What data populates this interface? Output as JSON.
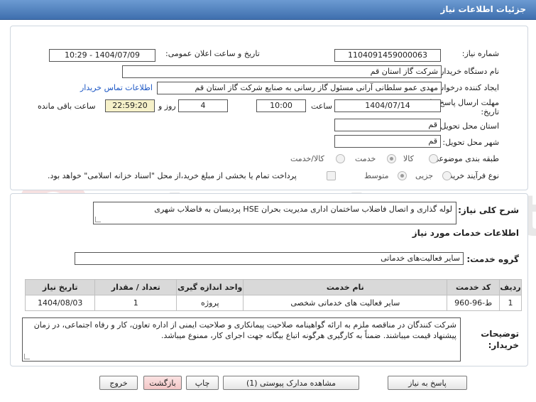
{
  "header": {
    "title": "جزئیات اطلاعات نیاز"
  },
  "form": {
    "need_number_label": "شماره نیاز:",
    "need_number": "1104091459000063",
    "announce_label": "تاریخ و ساعت اعلان عمومی:",
    "announce_value": "1404/07/09 - 10:29",
    "buyer_org_label": "نام دستگاه خریدار:",
    "buyer_org": "شرکت گاز استان قم",
    "requester_label": "ایجاد کننده درخواست:",
    "requester": "مهدی عمو سلطانی آرانی مسئول گاز رسانی به صنایع شرکت گاز استان قم",
    "contact_link": "اطلاعات تماس خریدار",
    "deadline_label_1": "مهلت ارسال پاسخ: تا",
    "deadline_label_2": "تاریخ:",
    "deadline_date": "1404/07/14",
    "time_label": "ساعت",
    "deadline_time": "10:00",
    "days_value": "4",
    "days_label": "روز و",
    "remaining_time": "22:59:20",
    "remaining_label": "ساعت باقی مانده",
    "province_label": "استان محل تحویل:",
    "province": "قم",
    "city_label": "شهر محل تحویل:",
    "city": "قم",
    "category_label": "طبقه بندی موضوعی:",
    "category_options": [
      "کالا",
      "خدمت",
      "کالا/خدمت"
    ],
    "process_label": "نوع فرآیند خرید :",
    "process_options": [
      "جزیی",
      "متوسط"
    ],
    "payment_note": "پرداخت تمام یا بخشی از مبلغ خرید،از محل \"اسناد خزانه اسلامی\" خواهد بود."
  },
  "need": {
    "summary_label": "شرح کلی نیاز:",
    "summary": "لوله گذاری و اتصال فاضلاب ساختمان اداری مدیریت بحران HSE پردیسان به فاضلاب شهری",
    "services_title": "اطلاعات خدمات مورد نیاز",
    "group_label": "گروه خدمت:",
    "group_value": "سایر فعالیت‌های خدماتی"
  },
  "table": {
    "headers": [
      "ردیف",
      "کد خدمت",
      "نام خدمت",
      "واحد اندازه گیری",
      "تعداد / مقدار",
      "تاریخ نیاز"
    ],
    "rows": [
      [
        "1",
        "ط-96-960",
        "سایر فعالیت های خدماتی شخصی",
        "پروژه",
        "1",
        "1404/08/03"
      ]
    ]
  },
  "buyer_notes": {
    "label_1": "توضیحات",
    "label_2": "خریدار:",
    "text": "شرکت کنندگان در مناقصه ملزم به ارائه گواهینامه صلاحیت پیمانکاری و صلاحیت ایمنی از اداره تعاون، کار و رفاه اجتماعی، در زمان پیشنهاد قیمت میباشند. ضمناً به کارگیری هرگونه اتباع بیگانه جهت اجرای کار، ممنوع میباشد."
  },
  "buttons": {
    "reply": "پاسخ به نیاز",
    "attachments": "مشاهده مدارک پیوستی (1)",
    "print": "چاپ",
    "back": "بازگشت",
    "exit": "خروج"
  }
}
